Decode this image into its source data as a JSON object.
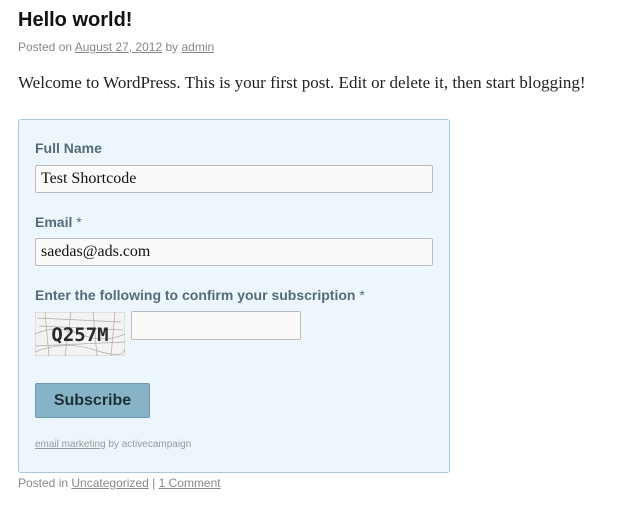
{
  "post": {
    "title": "Hello world!",
    "meta_prefix": "Posted on",
    "date": "August 27, 2012",
    "by_label": "by",
    "author": "admin",
    "body": "Welcome to WordPress. This is your first post. Edit or delete it, then start blogging!"
  },
  "form": {
    "full_name_label": "Full Name",
    "full_name_value": "Test Shortcode",
    "email_label": "Email",
    "email_value": "saedas@ads.com",
    "required_mark": "*",
    "captcha_label": "Enter the following to confirm your subscription",
    "captcha_text": "Q257M",
    "captcha_value": "",
    "subscribe_label": "Subscribe",
    "credit_link": "email marketing",
    "credit_suffix": "by activecampaign"
  },
  "footer": {
    "posted_in_label": "Posted in",
    "category": "Uncategorized",
    "separator": "|",
    "comments_link": "1 Comment"
  }
}
